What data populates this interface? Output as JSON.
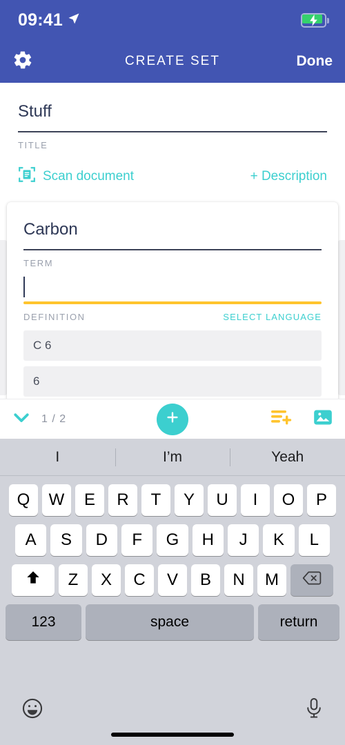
{
  "status_bar": {
    "time": "09:41",
    "location_icon": "location-arrow-icon",
    "battery_icon": "battery-charging-icon"
  },
  "nav_bar": {
    "settings_icon": "gear-icon",
    "title": "CREATE SET",
    "done_label": "Done",
    "background_color": "#4255B2"
  },
  "title_section": {
    "value": "Stuff",
    "placeholder": "Title",
    "label": "TITLE",
    "scan_icon": "scan-document-icon",
    "scan_label": "Scan document",
    "description_label": "+ Description",
    "accent_color": "#3ccfcf"
  },
  "card": {
    "term": {
      "value": "Carbon",
      "placeholder": "Term",
      "label": "TERM"
    },
    "definition": {
      "value": "",
      "placeholder": "Definition",
      "label": "DEFINITION",
      "select_language_label": "SELECT LANGUAGE",
      "underline_color": "#FFC42E",
      "focused": true
    },
    "suggestions": [
      "C 6",
      "6",
      ""
    ]
  },
  "toolbar": {
    "collapse_icon": "chevron-down-icon",
    "page_count": "1 / 2",
    "add_card_icon": "plus-icon",
    "add_definition_icon": "add-text-lines-icon",
    "add_image_icon": "image-icon",
    "accent_color": "#3ccfcf",
    "yellow_color": "#FFC42E"
  },
  "keyboard": {
    "suggestions": [
      "I",
      "I’m",
      "Yeah"
    ],
    "row1": [
      "Q",
      "W",
      "E",
      "R",
      "T",
      "Y",
      "U",
      "I",
      "O",
      "P"
    ],
    "row2": [
      "A",
      "S",
      "D",
      "F",
      "G",
      "H",
      "J",
      "K",
      "L"
    ],
    "row3": [
      "Z",
      "X",
      "C",
      "V",
      "B",
      "N",
      "M"
    ],
    "shift_icon": "shift-up-icon",
    "backspace_icon": "backspace-icon",
    "numbers_label": "123",
    "space_label": "space",
    "return_label": "return",
    "emoji_icon": "emoji-smiley-icon",
    "mic_icon": "microphone-icon"
  }
}
